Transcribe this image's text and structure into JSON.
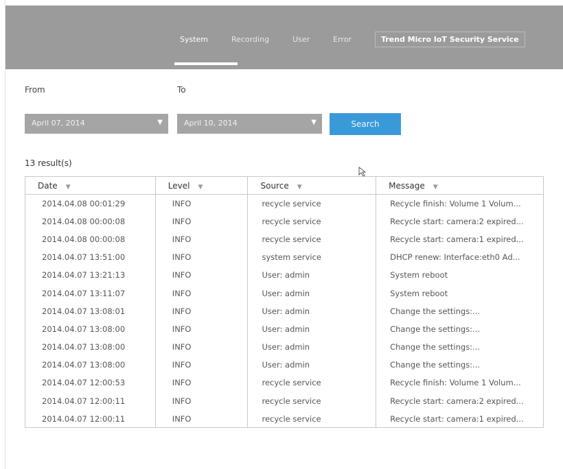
{
  "tabs": [
    {
      "label": "System",
      "active": true
    },
    {
      "label": "Recording",
      "active": false
    },
    {
      "label": "User",
      "active": false
    },
    {
      "label": "Error",
      "active": false
    },
    {
      "label": "Trend Micro IoT Security Service",
      "active": false
    }
  ],
  "filters": {
    "from_label": "From",
    "to_label": "To",
    "from_value": "April 07, 2014",
    "to_value": "April 10, 2014",
    "search_label": "Search"
  },
  "results_count": "13 result(s)",
  "table": {
    "columns": [
      "Date",
      "Level",
      "Source",
      "Message"
    ],
    "rows": [
      [
        "2014.04.08 00:01:29",
        "INFO",
        "recycle service",
        "Recycle finish: Volume 1 Volum..."
      ],
      [
        "2014.04.08 00:00:08",
        "INFO",
        "recycle service",
        "Recycle start: camera:2 expired..."
      ],
      [
        "2014.04.08 00:00:08",
        "INFO",
        "recycle service",
        "Recycle start: camera:1 expired..."
      ],
      [
        "2014.04.07 13:51:00",
        "INFO",
        "system service",
        "DHCP renew: Interface:eth0 Ad..."
      ],
      [
        "2014.04.07 13:21:13",
        "INFO",
        "User: admin",
        "System reboot"
      ],
      [
        "2014.04.07 13:11:07",
        "INFO",
        "User: admin",
        "System reboot"
      ],
      [
        "2014.04.07 13:08:01",
        "INFO",
        "User: admin",
        "Change the settings:..."
      ],
      [
        "2014.04.07 13:08:00",
        "INFO",
        "User: admin",
        "Change the settings:..."
      ],
      [
        "2014.04.07 13:08:00",
        "INFO",
        "User: admin",
        "Change the settings:..."
      ],
      [
        "2014.04.07 13:08:00",
        "INFO",
        "User: admin",
        "Change the settings:..."
      ],
      [
        "2014.04.07 12:00:53",
        "INFO",
        "recycle service",
        "Recycle finish: Volume 1 Volum..."
      ],
      [
        "2014.04.07 12:00:11",
        "INFO",
        "recycle service",
        "Recycle start: camera:2 expired..."
      ],
      [
        "2014.04.07 12:00:11",
        "INFO",
        "recycle service",
        "Recycle start: camera:1 expired..."
      ]
    ]
  },
  "icons": {
    "dropdown": "chevron-down-icon",
    "sort": "sort-down-icon",
    "cursor": "mouse-pointer-icon"
  },
  "colors": {
    "header_bg": "#9b9b9b",
    "accent": "#3a9ad9",
    "select_bg": "#a5a5a5"
  }
}
